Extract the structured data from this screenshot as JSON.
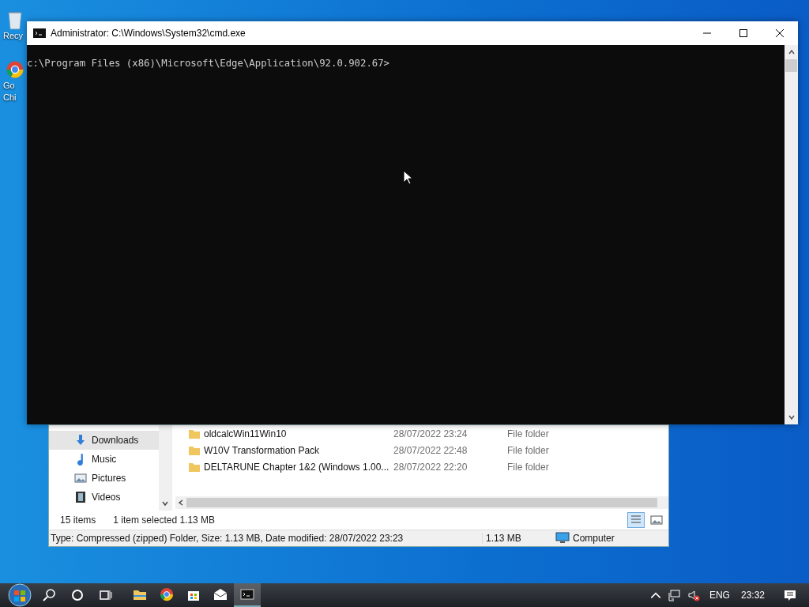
{
  "desktop_icons": [
    {
      "labels": [
        "Recy"
      ],
      "kind": "bin"
    },
    {
      "labels": [
        "Go",
        "Chi"
      ],
      "kind": "browser"
    }
  ],
  "explorer": {
    "nav_items": [
      {
        "label": "Downloads",
        "kind": "download",
        "selected": true
      },
      {
        "label": "Music",
        "kind": "music",
        "selected": false
      },
      {
        "label": "Pictures",
        "kind": "pictures",
        "selected": false
      },
      {
        "label": "Videos",
        "kind": "videos",
        "selected": false
      }
    ],
    "files": [
      {
        "name": "oldcalcWin11Win10",
        "date": "28/07/2022 23:24",
        "type": "File folder"
      },
      {
        "name": "W10V Transformation Pack",
        "date": "28/07/2022 22:48",
        "type": "File folder"
      },
      {
        "name": "DELTARUNE Chapter 1&2 (Windows 1.00...",
        "date": "28/07/2022 22:20",
        "type": "File folder"
      }
    ],
    "status": {
      "count": "15 items",
      "selection": "1 item selected  1.13 MB"
    },
    "details_bar": {
      "text": "Type: Compressed (zipped) Folder, Size: 1.13 MB, Date modified: 28/07/2022 23:23",
      "size": "1.13 MB",
      "location": "Computer"
    }
  },
  "console": {
    "title": "Administrator: C:\\Windows\\System32\\cmd.exe",
    "prompt": "c:\\Program Files (x86)\\Microsoft\\Edge\\Application\\92.0.902.67>"
  },
  "taskbar": {
    "apps": [
      {
        "kind": "explorer",
        "active": false
      },
      {
        "kind": "chrome",
        "active": false
      },
      {
        "kind": "store",
        "active": false
      },
      {
        "kind": "mail",
        "active": false
      },
      {
        "kind": "cmd",
        "active": true
      }
    ],
    "language": "ENG",
    "time": "23:32"
  }
}
